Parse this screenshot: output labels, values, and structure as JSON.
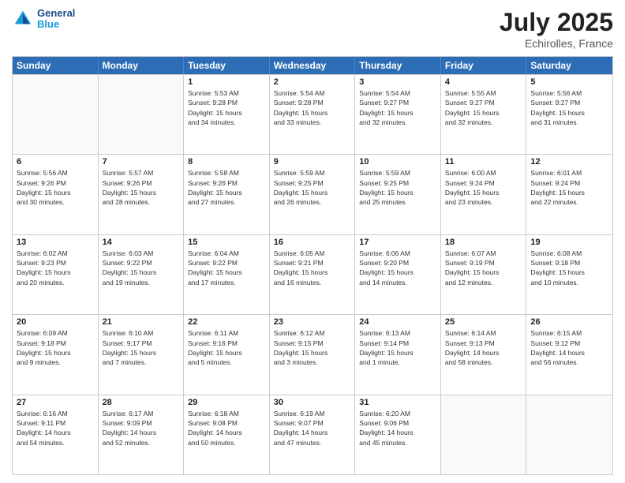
{
  "header": {
    "logo_line1": "General",
    "logo_line2": "Blue",
    "month_year": "July 2025",
    "location": "Echirolles, France"
  },
  "weekdays": [
    "Sunday",
    "Monday",
    "Tuesday",
    "Wednesday",
    "Thursday",
    "Friday",
    "Saturday"
  ],
  "rows": [
    [
      {
        "day": "",
        "info": ""
      },
      {
        "day": "",
        "info": ""
      },
      {
        "day": "1",
        "info": "Sunrise: 5:53 AM\nSunset: 9:28 PM\nDaylight: 15 hours\nand 34 minutes."
      },
      {
        "day": "2",
        "info": "Sunrise: 5:54 AM\nSunset: 9:28 PM\nDaylight: 15 hours\nand 33 minutes."
      },
      {
        "day": "3",
        "info": "Sunrise: 5:54 AM\nSunset: 9:27 PM\nDaylight: 15 hours\nand 32 minutes."
      },
      {
        "day": "4",
        "info": "Sunrise: 5:55 AM\nSunset: 9:27 PM\nDaylight: 15 hours\nand 32 minutes."
      },
      {
        "day": "5",
        "info": "Sunrise: 5:56 AM\nSunset: 9:27 PM\nDaylight: 15 hours\nand 31 minutes."
      }
    ],
    [
      {
        "day": "6",
        "info": "Sunrise: 5:56 AM\nSunset: 9:26 PM\nDaylight: 15 hours\nand 30 minutes."
      },
      {
        "day": "7",
        "info": "Sunrise: 5:57 AM\nSunset: 9:26 PM\nDaylight: 15 hours\nand 28 minutes."
      },
      {
        "day": "8",
        "info": "Sunrise: 5:58 AM\nSunset: 9:26 PM\nDaylight: 15 hours\nand 27 minutes."
      },
      {
        "day": "9",
        "info": "Sunrise: 5:59 AM\nSunset: 9:25 PM\nDaylight: 15 hours\nand 26 minutes."
      },
      {
        "day": "10",
        "info": "Sunrise: 5:59 AM\nSunset: 9:25 PM\nDaylight: 15 hours\nand 25 minutes."
      },
      {
        "day": "11",
        "info": "Sunrise: 6:00 AM\nSunset: 9:24 PM\nDaylight: 15 hours\nand 23 minutes."
      },
      {
        "day": "12",
        "info": "Sunrise: 6:01 AM\nSunset: 9:24 PM\nDaylight: 15 hours\nand 22 minutes."
      }
    ],
    [
      {
        "day": "13",
        "info": "Sunrise: 6:02 AM\nSunset: 9:23 PM\nDaylight: 15 hours\nand 20 minutes."
      },
      {
        "day": "14",
        "info": "Sunrise: 6:03 AM\nSunset: 9:22 PM\nDaylight: 15 hours\nand 19 minutes."
      },
      {
        "day": "15",
        "info": "Sunrise: 6:04 AM\nSunset: 9:22 PM\nDaylight: 15 hours\nand 17 minutes."
      },
      {
        "day": "16",
        "info": "Sunrise: 6:05 AM\nSunset: 9:21 PM\nDaylight: 15 hours\nand 16 minutes."
      },
      {
        "day": "17",
        "info": "Sunrise: 6:06 AM\nSunset: 9:20 PM\nDaylight: 15 hours\nand 14 minutes."
      },
      {
        "day": "18",
        "info": "Sunrise: 6:07 AM\nSunset: 9:19 PM\nDaylight: 15 hours\nand 12 minutes."
      },
      {
        "day": "19",
        "info": "Sunrise: 6:08 AM\nSunset: 9:18 PM\nDaylight: 15 hours\nand 10 minutes."
      }
    ],
    [
      {
        "day": "20",
        "info": "Sunrise: 6:09 AM\nSunset: 9:18 PM\nDaylight: 15 hours\nand 9 minutes."
      },
      {
        "day": "21",
        "info": "Sunrise: 6:10 AM\nSunset: 9:17 PM\nDaylight: 15 hours\nand 7 minutes."
      },
      {
        "day": "22",
        "info": "Sunrise: 6:11 AM\nSunset: 9:16 PM\nDaylight: 15 hours\nand 5 minutes."
      },
      {
        "day": "23",
        "info": "Sunrise: 6:12 AM\nSunset: 9:15 PM\nDaylight: 15 hours\nand 3 minutes."
      },
      {
        "day": "24",
        "info": "Sunrise: 6:13 AM\nSunset: 9:14 PM\nDaylight: 15 hours\nand 1 minute."
      },
      {
        "day": "25",
        "info": "Sunrise: 6:14 AM\nSunset: 9:13 PM\nDaylight: 14 hours\nand 58 minutes."
      },
      {
        "day": "26",
        "info": "Sunrise: 6:15 AM\nSunset: 9:12 PM\nDaylight: 14 hours\nand 56 minutes."
      }
    ],
    [
      {
        "day": "27",
        "info": "Sunrise: 6:16 AM\nSunset: 9:11 PM\nDaylight: 14 hours\nand 54 minutes."
      },
      {
        "day": "28",
        "info": "Sunrise: 6:17 AM\nSunset: 9:09 PM\nDaylight: 14 hours\nand 52 minutes."
      },
      {
        "day": "29",
        "info": "Sunrise: 6:18 AM\nSunset: 9:08 PM\nDaylight: 14 hours\nand 50 minutes."
      },
      {
        "day": "30",
        "info": "Sunrise: 6:19 AM\nSunset: 9:07 PM\nDaylight: 14 hours\nand 47 minutes."
      },
      {
        "day": "31",
        "info": "Sunrise: 6:20 AM\nSunset: 9:06 PM\nDaylight: 14 hours\nand 45 minutes."
      },
      {
        "day": "",
        "info": ""
      },
      {
        "day": "",
        "info": ""
      }
    ]
  ]
}
